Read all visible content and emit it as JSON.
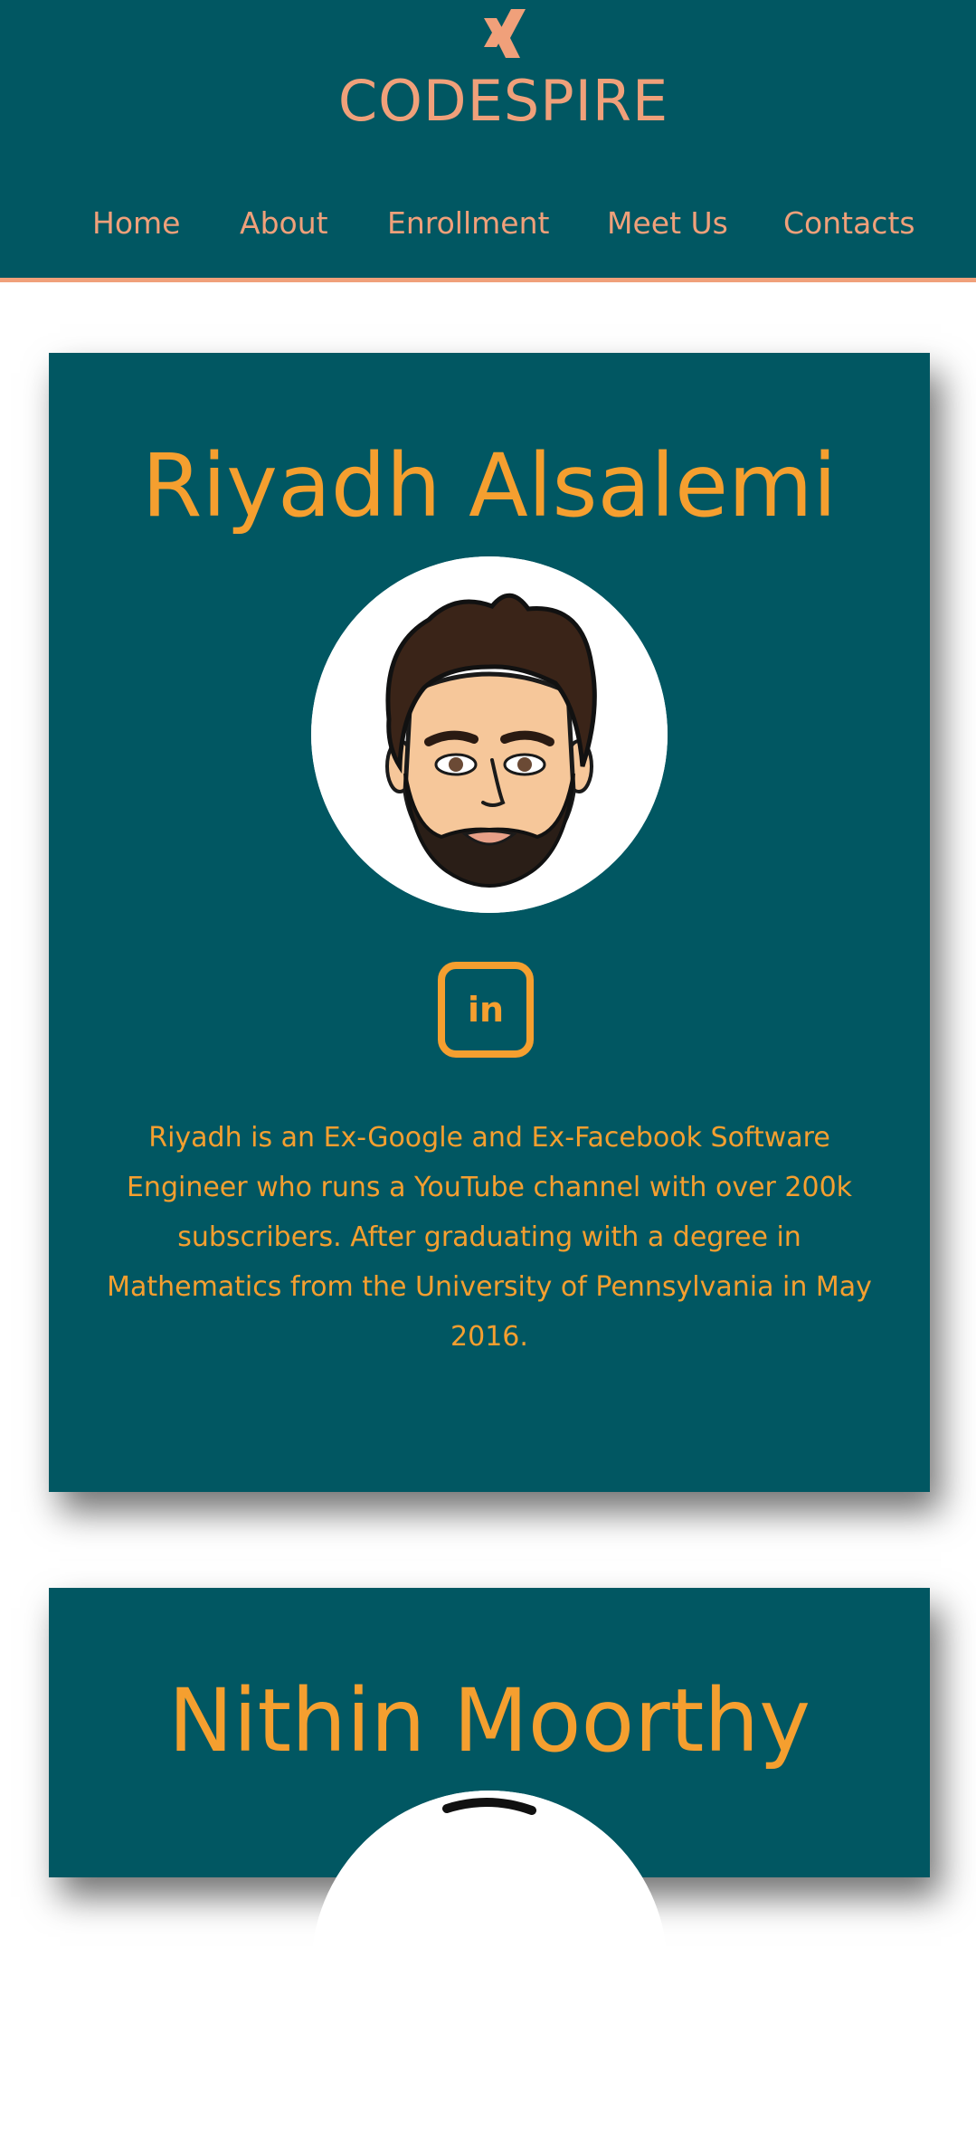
{
  "header": {
    "brand": "CODESPIRE",
    "logo_icon": "xing-logo-icon",
    "nav": [
      {
        "label": "Home"
      },
      {
        "label": "About"
      },
      {
        "label": "Enrollment"
      },
      {
        "label": "Meet Us"
      },
      {
        "label": "Contacts"
      }
    ]
  },
  "team": [
    {
      "name": "Riyadh Alsalemi",
      "linkedin_label": "in",
      "bio": "Riyadh is an Ex-Google and Ex-Facebook Software Engineer who runs a YouTube channel with over 200k subscribers. After graduating with a degree in Mathematics from the University of Pennsylvania in May 2016."
    },
    {
      "name": "Nithin Moorthy"
    }
  ],
  "colors": {
    "primary_bg": "#015762",
    "accent_orange": "#f59f2f",
    "accent_peach": "#f0a07a"
  }
}
